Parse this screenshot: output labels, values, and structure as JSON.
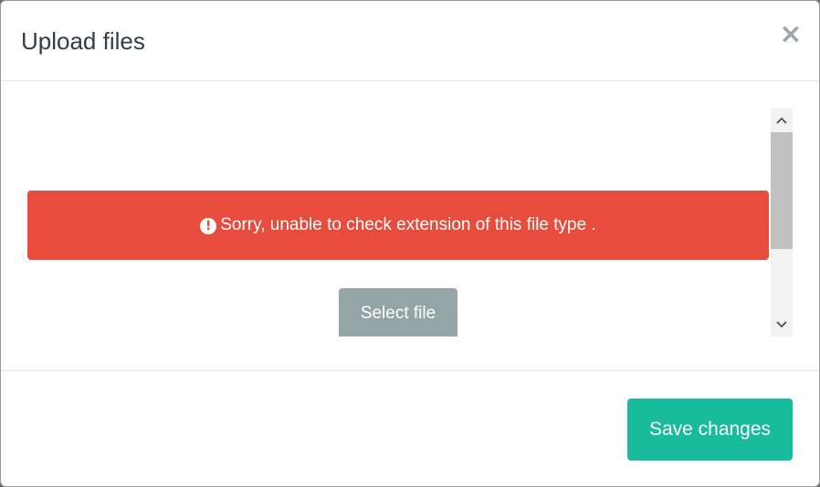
{
  "dialog": {
    "title": "Upload files",
    "close_symbol": "×"
  },
  "alert": {
    "icon": "exclamation-circle-icon",
    "icon_glyph": "!",
    "message": "Sorry, unable to check extension of this file type ."
  },
  "body": {
    "select_file_label": "Select file"
  },
  "scrollbar": {
    "up_glyph": "⌃",
    "down_glyph": "⌄"
  },
  "footer": {
    "save_label": "Save changes"
  },
  "colors": {
    "title": "#2c3e50",
    "alert_bg": "#e74c3c",
    "select_btn_bg": "#95a5a6",
    "save_btn_bg": "#18bc9c"
  }
}
